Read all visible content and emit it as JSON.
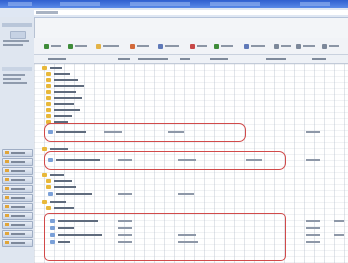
{
  "window": {
    "title_bar_color": "#2f5fd0",
    "highlight_color": "#d14a4a",
    "folder_color": "#e8b83a"
  },
  "icons": {
    "folder": "folder-icon",
    "file": "file-icon",
    "view": "view-icon"
  }
}
